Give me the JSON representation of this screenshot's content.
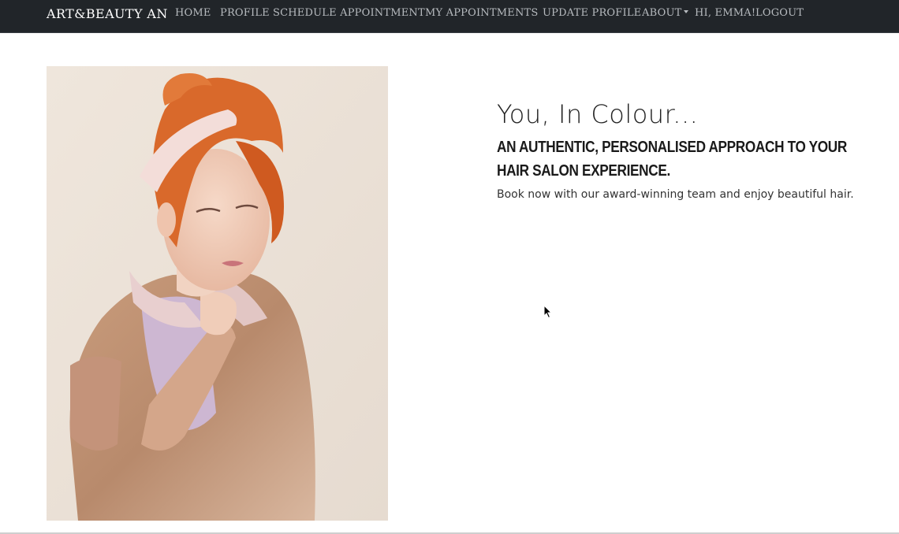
{
  "navbar": {
    "brand": "ART&BEAUTY AN",
    "links": [
      "HOME",
      "PROFILE",
      "SCHEDULE APPOINTMENT",
      "MY APPOINTMENTS",
      "UPDATE PROFILE",
      "ABOUT",
      "HI, EMMA!",
      "LOGOUT"
    ]
  },
  "hero": {
    "title": "You, In Colour...",
    "subtitle": "AN AUTHENTIC, PERSONALISED APPROACH TO YOUR HAIR SALON EXPERIENCE.",
    "body": "Book now with our award-winning team and enjoy beautiful hair."
  },
  "colors": {
    "navbar_bg": "#212529",
    "nav_link": "#b7bbbf",
    "brand": "#ffffff"
  }
}
